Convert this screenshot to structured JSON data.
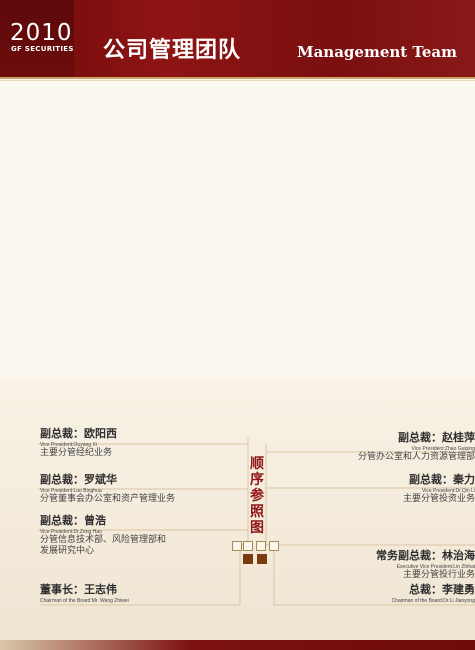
{
  "header": {
    "year": "2010",
    "brand": "GF SECURITIES",
    "title_cn": "公司管理团队",
    "title_en": "Management Team"
  },
  "center_label": [
    "顺",
    "序",
    "参",
    "照",
    "图"
  ],
  "colors": {
    "brand_red": "#8e1414",
    "gold": "#c8a566",
    "accent_brown": "#7b3b10"
  },
  "left": [
    {
      "role": "副总裁：欧阳西",
      "en": "Vice President:Ouyang Xi",
      "desc": [
        "主要分管经纪业务"
      ]
    },
    {
      "role": "副总裁：罗斌华",
      "en": "Vice President:Luo Binghua",
      "desc": [
        "分管董事会办公室和资产管理业务"
      ]
    },
    {
      "role": "副总裁：曾浩",
      "en": "Vice President:Dr.Zeng Hao",
      "desc": [
        "分管信息技术部、风险管理部和",
        "发展研究中心"
      ]
    },
    {
      "role": "董事长：王志伟",
      "en": "Chairman of the Board:Mr. Wang Zhiwei",
      "desc": []
    }
  ],
  "right": [
    {
      "role": "副总裁：赵桂萍",
      "en": "Vice President:Zhao Guiping",
      "desc": [
        "分管办公室和人力资源管理部"
      ]
    },
    {
      "role": "副总裁：秦力",
      "en": "Vice President:Dr.Qin Li",
      "desc": [
        "主要分管投资业务"
      ]
    },
    {
      "role": "常务副总裁：林治海",
      "en": "Executive Vice President:Lin Zhihai",
      "desc": [
        "主要分管投行业务"
      ]
    },
    {
      "role": "总裁：李建勇",
      "en": "Chairman of the Board:Dr.Li Jianyong",
      "desc": []
    }
  ]
}
